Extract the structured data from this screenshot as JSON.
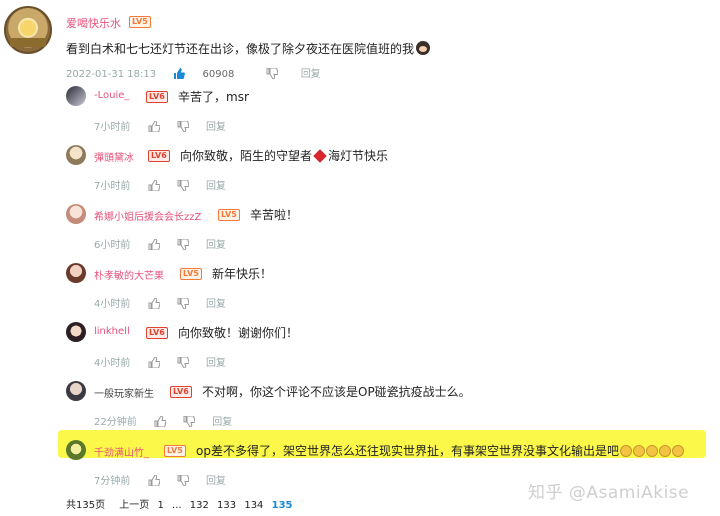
{
  "main_comment": {
    "username": "爱喝快乐水",
    "level": "LV5",
    "text": "看到白术和七七还灯节还在出诊，像极了除夕夜还在医院值班的我",
    "date": "2022-01-31 18:13",
    "likes": "60908",
    "reply_label": "回复"
  },
  "replies": [
    {
      "username": "-Louie_",
      "level": "LV6",
      "text": "辛苦了，msr",
      "time": "7小时前",
      "reply_label": "回复",
      "name_color": "#e5527c",
      "lv_color": "#e0422c"
    },
    {
      "username": "彈頭黛冰",
      "level": "LV6",
      "text_a": "向你致敬，陌生的守望者",
      "text_b": "海灯节快乐",
      "time": "7小时前",
      "reply_label": "回复",
      "name_color": "#e5527c",
      "lv_color": "#e0422c"
    },
    {
      "username": "希娜小姐后援会会长zzZ",
      "level": "LV5",
      "text": "辛苦啦！",
      "time": "6小时前",
      "reply_label": "回复",
      "name_color": "#e5527c",
      "lv_color": "#f37a3a"
    },
    {
      "username": "朴孝敏的大芒果",
      "level": "LV5",
      "text": "新年快乐！",
      "time": "4小时前",
      "reply_label": "回复",
      "name_color": "#e5527c",
      "lv_color": "#f37a3a"
    },
    {
      "username": "linkhell",
      "level": "LV6",
      "text": "向你致敬！谢谢你们！",
      "time": "4小时前",
      "reply_label": "回复",
      "name_color": "#e5527c",
      "lv_color": "#e0422c"
    },
    {
      "username": "一般玩家新生",
      "level": "LV6",
      "text": "不对啊，你这个评论不应该是OP碰瓷抗疫战士么。",
      "time": "22分钟前",
      "reply_label": "回复",
      "name_color": "#444444",
      "lv_color": "#e0422c"
    },
    {
      "username": "千劲满山竹_",
      "level": "LV5",
      "text": "op差不多得了，架空世界怎么还往现实世界扯，有事架空世界没事文化输出是吧",
      "time": "7分钟前",
      "reply_label": "回复",
      "name_color": "#e5527c",
      "lv_color": "#f37a3a"
    }
  ],
  "pager": {
    "total": "共135页",
    "prev": "上一页",
    "p1": "1",
    "ellipsis": "...",
    "p132": "132",
    "p133": "133",
    "p134": "134",
    "p135": "135"
  },
  "watermark": "知乎 @AsamiAkise",
  "icons": {
    "like": "thumbs-up-icon",
    "dislike": "thumbs-down-icon"
  },
  "colors": {
    "accent": "#1a8ad6",
    "highlight": "#fcf84a",
    "username_pink": "#e5527c"
  }
}
